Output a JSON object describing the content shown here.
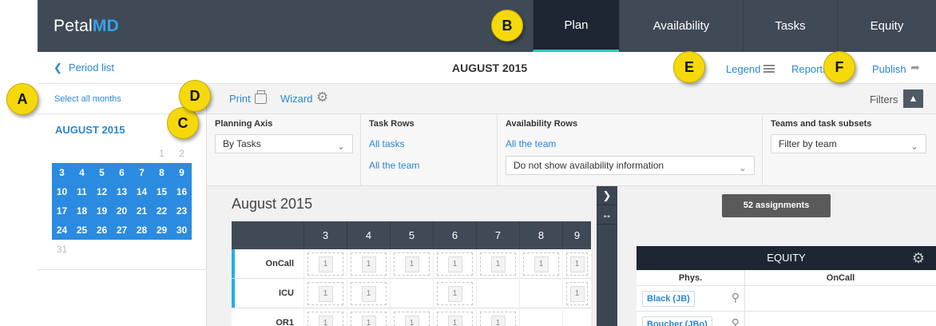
{
  "brand": {
    "name_plain": "Petal",
    "name_accent": "MD"
  },
  "nav": {
    "tabs": [
      {
        "label": "Plan",
        "active": true
      },
      {
        "label": "Availability"
      },
      {
        "label": "Tasks"
      },
      {
        "label": "Equity"
      }
    ]
  },
  "subheader": {
    "back_label": "Period list",
    "title": "AUGUST 2015",
    "legend_label": "Legend",
    "reports_label": "Reports",
    "publish_label": "Publish"
  },
  "month_panel": {
    "select_all": "Select all months",
    "calendar_title": "AUGUST 2015",
    "weeks": [
      [
        {
          "d": ""
        },
        {
          "d": ""
        },
        {
          "d": ""
        },
        {
          "d": ""
        },
        {
          "d": ""
        },
        {
          "d": "1"
        },
        {
          "d": "2"
        }
      ],
      [
        {
          "d": "3",
          "sel": true
        },
        {
          "d": "4",
          "sel": true
        },
        {
          "d": "5",
          "sel": true
        },
        {
          "d": "6",
          "sel": true
        },
        {
          "d": "7",
          "sel": true
        },
        {
          "d": "8",
          "sel": true
        },
        {
          "d": "9",
          "sel": true
        }
      ],
      [
        {
          "d": "10",
          "sel": true
        },
        {
          "d": "11",
          "sel": true
        },
        {
          "d": "12",
          "sel": true
        },
        {
          "d": "13",
          "sel": true
        },
        {
          "d": "14",
          "sel": true
        },
        {
          "d": "15",
          "sel": true
        },
        {
          "d": "16",
          "sel": true
        }
      ],
      [
        {
          "d": "17",
          "sel": true
        },
        {
          "d": "18",
          "sel": true
        },
        {
          "d": "19",
          "sel": true
        },
        {
          "d": "20",
          "sel": true
        },
        {
          "d": "21",
          "sel": true
        },
        {
          "d": "22",
          "sel": true
        },
        {
          "d": "23",
          "sel": true
        }
      ],
      [
        {
          "d": "24",
          "sel": true
        },
        {
          "d": "25",
          "sel": true
        },
        {
          "d": "26",
          "sel": true
        },
        {
          "d": "27",
          "sel": true
        },
        {
          "d": "28",
          "sel": true
        },
        {
          "d": "29",
          "sel": true
        },
        {
          "d": "30",
          "sel": true
        }
      ],
      [
        {
          "d": "31"
        },
        {
          "d": ""
        },
        {
          "d": ""
        },
        {
          "d": ""
        },
        {
          "d": ""
        },
        {
          "d": ""
        },
        {
          "d": ""
        }
      ]
    ]
  },
  "toolbar": {
    "print_label": "Print",
    "wizard_label": "Wizard",
    "filters_label": "Filters"
  },
  "filters": {
    "planning_axis": {
      "label": "Planning Axis",
      "value": "By Tasks"
    },
    "task_rows": {
      "label": "Task Rows",
      "link1": "All tasks",
      "link2": "All the team"
    },
    "availability_rows": {
      "label": "Availability Rows",
      "link1": "All the team",
      "value": "Do not show availability information"
    },
    "teams": {
      "label": "Teams and task subsets",
      "value": "Filter by team"
    }
  },
  "schedule": {
    "title": "August 2015",
    "days": [
      "3",
      "4",
      "5",
      "6",
      "7",
      "8",
      "9"
    ],
    "rows": [
      {
        "name": "OnCall",
        "cells": [
          "1",
          "1",
          "1",
          "1",
          "1",
          "1",
          "1"
        ]
      },
      {
        "name": "ICU",
        "cells": [
          "1",
          "1",
          "",
          "1",
          "",
          "",
          "1"
        ]
      },
      {
        "name": "OR1",
        "cells": [
          "1",
          "1",
          "1",
          "1",
          "1",
          "",
          ""
        ]
      }
    ]
  },
  "assignments_label": "52 assignments",
  "equity": {
    "title": "EQUITY",
    "col_phys": "Phys.",
    "col_oncall": "OnCall",
    "rows": [
      {
        "name": "Black (JB)"
      },
      {
        "name": "Boucher (JBo)"
      }
    ]
  },
  "callouts": [
    "A",
    "B",
    "C",
    "D",
    "E",
    "F"
  ],
  "colors": {
    "topbar": "#404a57",
    "active_tab": "#1e2633",
    "accent": "#2a87d0",
    "selected_day": "#2a8be0",
    "callout": "#f5d90a"
  }
}
